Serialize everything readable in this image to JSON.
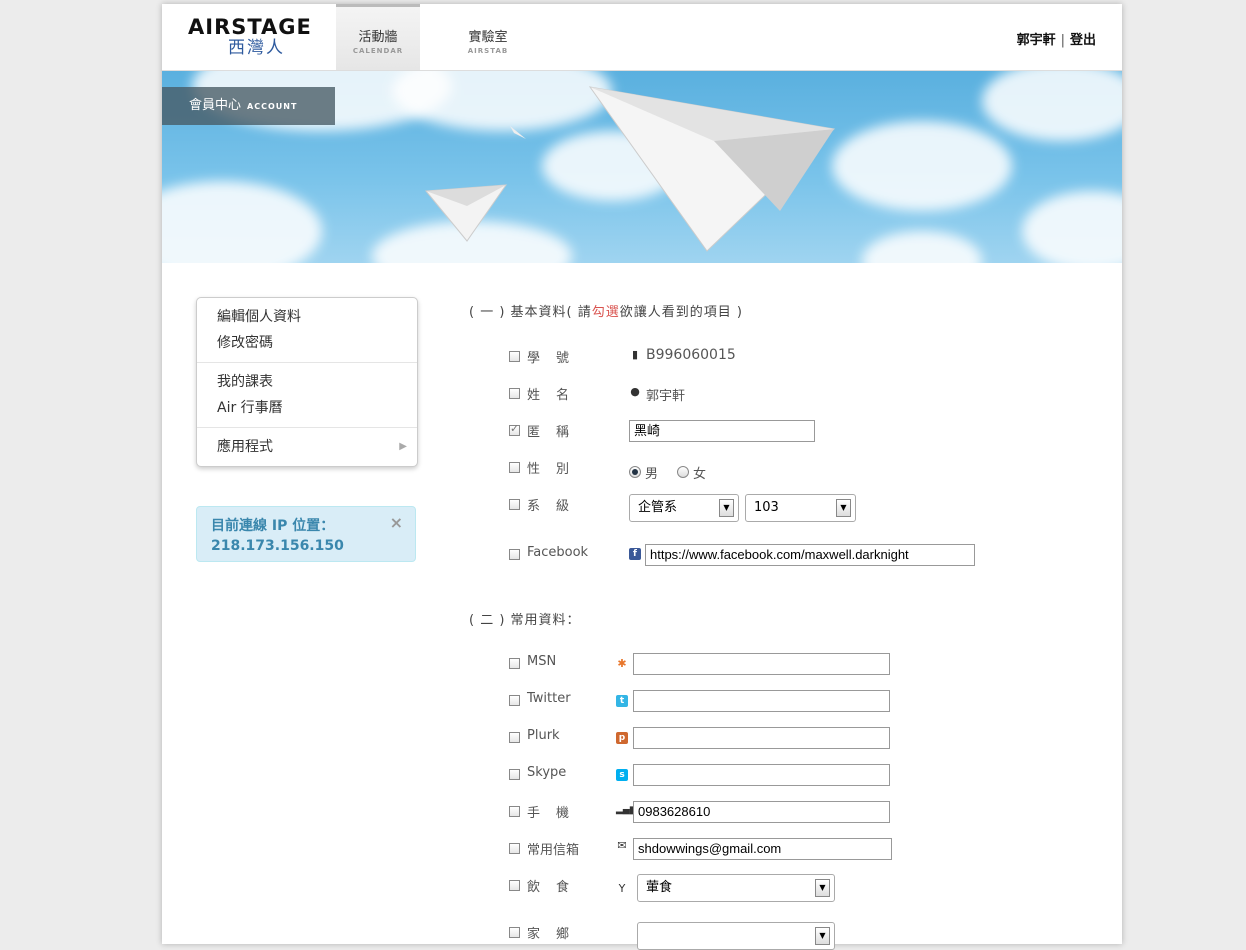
{
  "header": {
    "logo_main": "AIRSTAGE",
    "logo_sub": "西灣人",
    "tabs": [
      {
        "label": "活動牆",
        "sub": "CALENDAR"
      },
      {
        "label": "實驗室",
        "sub": "AIRSTAB"
      }
    ],
    "user_name": "郭宇軒",
    "separator": "|",
    "logout": "登出"
  },
  "banner": {
    "account_label": "會員中心",
    "account_sub": "ACCOUNT"
  },
  "menu": {
    "items": [
      "編輯個人資料",
      "修改密碼",
      "我的課表",
      "Air 行事曆",
      "應用程式"
    ],
    "submenu_arrow": "▶"
  },
  "ip_box": {
    "label": "目前連線 IP 位置：",
    "ip": "218.173.156.150",
    "close": "×"
  },
  "section1": {
    "title_prefix": "( 一 ) 基本資料( 請",
    "title_red": "勾選",
    "title_suffix": "欲讓人看到的項目 )",
    "student_id_label": "學號",
    "student_id": "B996060015",
    "name_label": "姓名",
    "name": "郭宇軒",
    "nickname_label": "匿稱",
    "nickname": "黑崎",
    "gender_label": "性別",
    "gender_male": "男",
    "gender_female": "女",
    "gender_selected": "男",
    "dept_label": "系級",
    "dept_value": "企管系",
    "year_value": "103",
    "facebook_label": "Facebook",
    "facebook_url": "https://www.facebook.com/maxwell.darknight"
  },
  "section2": {
    "title": "( 二 ) 常用資料：",
    "msn_label": "MSN",
    "msn": "",
    "twitter_label": "Twitter",
    "twitter": "",
    "plurk_label": "Plurk",
    "plurk": "",
    "skype_label": "Skype",
    "skype": "",
    "phone_label": "手機",
    "phone": "0983628610",
    "email_label": "常用信箱",
    "email": "shdowwings@gmail.com",
    "diet_label": "飲食",
    "diet_value": "葷食",
    "hometown_label": "家鄉"
  },
  "icons": {
    "id_card": "id-card-icon",
    "person": "person-icon",
    "facebook": "facebook-icon",
    "msn": "msn-icon",
    "twitter": "twitter-icon",
    "plurk": "plurk-icon",
    "skype": "skype-icon",
    "phone": "signal-icon",
    "email": "envelope-icon",
    "diet": "cocktail-icon"
  },
  "colors": {
    "accent_red": "#d9534f",
    "info_bg": "#d9edf7",
    "info_text": "#3a87ad",
    "sky": "#6dbbe6"
  }
}
